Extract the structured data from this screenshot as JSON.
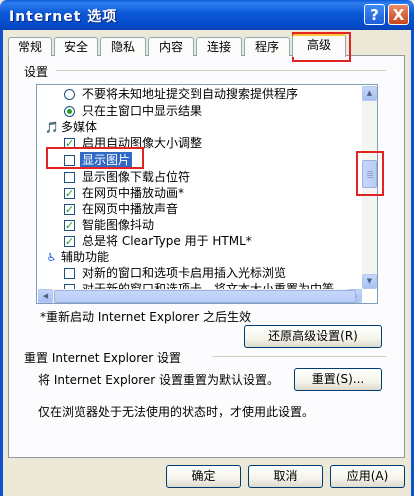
{
  "window": {
    "title": "Internet 选项",
    "help_button": "?",
    "close_button": "X"
  },
  "tabs": [
    "常规",
    "安全",
    "隐私",
    "内容",
    "连接",
    "程序",
    "高级"
  ],
  "settings_group": {
    "label": "设置",
    "items": [
      {
        "type": "radio",
        "checked": false,
        "text": "不要将未知地址提交到自动搜索提供程序"
      },
      {
        "type": "radio",
        "checked": true,
        "text": "只在主窗口中显示结果"
      },
      {
        "type": "category",
        "icon": "multimedia-icon",
        "text": "多媒体"
      },
      {
        "type": "checkbox",
        "checked": true,
        "text": "启用自动图像大小调整"
      },
      {
        "type": "checkbox",
        "checked": false,
        "text": "显示图片",
        "selected": true
      },
      {
        "type": "checkbox",
        "checked": false,
        "text": "显示图像下载占位符"
      },
      {
        "type": "checkbox",
        "checked": true,
        "text": "在网页中播放动画*"
      },
      {
        "type": "checkbox",
        "checked": true,
        "text": "在网页中播放声音"
      },
      {
        "type": "checkbox",
        "checked": true,
        "text": "智能图像抖动"
      },
      {
        "type": "checkbox",
        "checked": true,
        "text": "总是将 ClearType 用于 HTML*"
      },
      {
        "type": "category",
        "icon": "accessibility-icon",
        "text": "辅助功能"
      },
      {
        "type": "checkbox",
        "checked": false,
        "text": "对新的窗口和选项卡启用插入光标浏览"
      },
      {
        "type": "checkbox",
        "checked": false,
        "text": "对于新的窗口和选项卡，将文本大小重置为中等"
      }
    ]
  },
  "restart_note": "*重新启动 Internet Explorer 之后生效",
  "restore_button": "还原高级设置(R)",
  "reset_section": {
    "title": "重置 Internet Explorer 设置",
    "description": "将 Internet Explorer 设置重置为默认设置。",
    "reset_button": "重置(S)...",
    "note": "仅在浏览器处于无法使用的状态时，才使用此设置。"
  },
  "footer": {
    "ok": "确定",
    "cancel": "取消",
    "apply": "应用(A)"
  },
  "colors": {
    "highlight": "#e02424",
    "selection": "#316ac5",
    "title_bar": "#0a58d6"
  }
}
